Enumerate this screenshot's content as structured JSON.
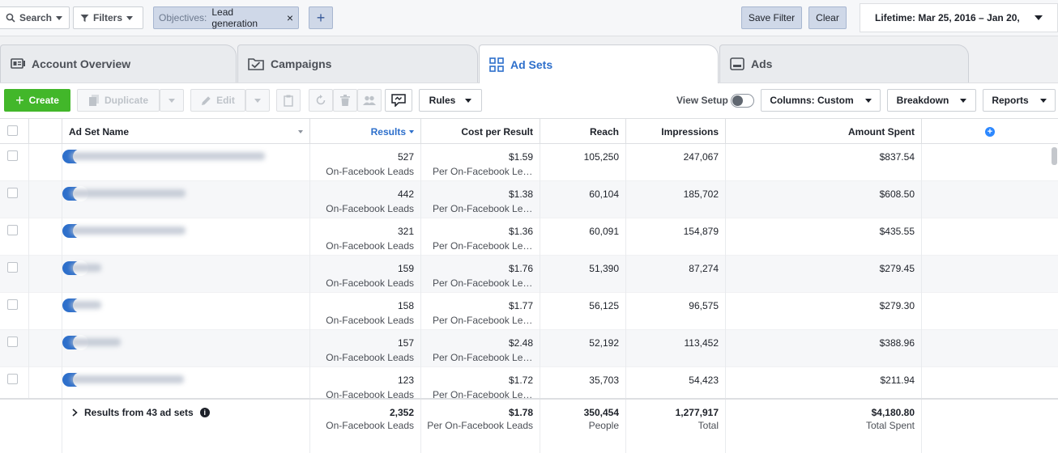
{
  "filterbar": {
    "search_label": "Search",
    "filters_label": "Filters",
    "chip_key": "Objectives:",
    "chip_value": "Lead generation",
    "chip_remove": "×",
    "add_filter": "+",
    "save_filter_label": "Save Filter",
    "clear_label": "Clear",
    "date_range": "Lifetime: Mar 25, 2016 – Jan 20,"
  },
  "tabs": [
    {
      "label": "Account Overview",
      "icon": "dashboard-icon",
      "active": false
    },
    {
      "label": "Campaigns",
      "icon": "folder-icon",
      "active": false
    },
    {
      "label": "Ad Sets",
      "icon": "grid-icon",
      "active": true
    },
    {
      "label": "Ads",
      "icon": "ad-icon",
      "active": false
    }
  ],
  "toolbar": {
    "create_label": "Create",
    "duplicate_label": "Duplicate",
    "edit_label": "Edit",
    "rules_label": "Rules",
    "view_setup_label": "View Setup",
    "columns_label": "Columns: Custom",
    "breakdown_label": "Breakdown",
    "reports_label": "Reports"
  },
  "table": {
    "columns": {
      "name": "Ad Set Name",
      "results": "Results",
      "cost": "Cost per Result",
      "reach": "Reach",
      "impressions": "Impressions",
      "spent": "Amount Spent"
    },
    "rows": [
      {
        "results": "527",
        "results_sub": "On-Facebook Leads",
        "cost": "$1.59",
        "cost_sub": "Per On-Facebook Leads",
        "reach": "105,250",
        "impressions": "247,067",
        "spent": "$837.54"
      },
      {
        "results": "442",
        "results_sub": "On-Facebook Leads",
        "cost": "$1.38",
        "cost_sub": "Per On-Facebook Leads",
        "reach": "60,104",
        "impressions": "185,702",
        "spent": "$608.50"
      },
      {
        "results": "321",
        "results_sub": "On-Facebook Leads",
        "cost": "$1.36",
        "cost_sub": "Per On-Facebook Leads",
        "reach": "60,091",
        "impressions": "154,879",
        "spent": "$435.55"
      },
      {
        "results": "159",
        "results_sub": "On-Facebook Leads",
        "cost": "$1.76",
        "cost_sub": "Per On-Facebook Leads",
        "reach": "51,390",
        "impressions": "87,274",
        "spent": "$279.45"
      },
      {
        "results": "158",
        "results_sub": "On-Facebook Leads",
        "cost": "$1.77",
        "cost_sub": "Per On-Facebook Leads",
        "reach": "56,125",
        "impressions": "96,575",
        "spent": "$279.30"
      },
      {
        "results": "157",
        "results_sub": "On-Facebook Leads",
        "cost": "$2.48",
        "cost_sub": "Per On-Facebook Leads",
        "reach": "52,192",
        "impressions": "113,452",
        "spent": "$388.96"
      },
      {
        "results": "123",
        "results_sub": "On-Facebook Leads",
        "cost": "$1.72",
        "cost_sub": "Per On-Facebook Leads",
        "reach": "35,703",
        "impressions": "54,423",
        "spent": "$211.94"
      }
    ],
    "summary": {
      "label": "Results from 43 ad sets",
      "results": "2,352",
      "results_sub": "On-Facebook Leads",
      "cost": "$1.78",
      "cost_sub": "Per On-Facebook Leads",
      "reach": "350,454",
      "reach_sub": "People",
      "impressions": "1,277,917",
      "impressions_sub": "Total",
      "spent": "$4,180.80",
      "spent_sub": "Total Spent"
    }
  },
  "colors": {
    "accent": "#2d6fcb",
    "create_green": "#42b72a",
    "chip_bg": "#cfd8e8"
  }
}
